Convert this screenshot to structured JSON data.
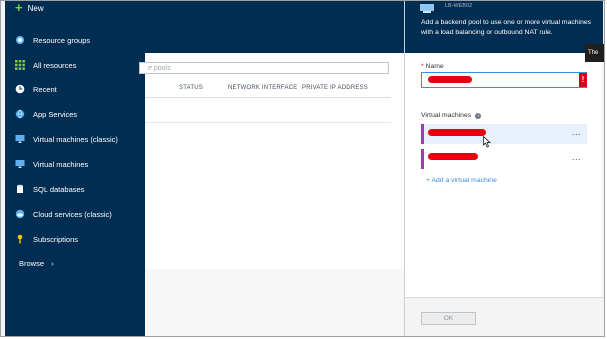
{
  "sidebar": {
    "new_label": "New",
    "items": [
      {
        "label": "Resource groups",
        "icon": "resource-groups-icon"
      },
      {
        "label": "All resources",
        "icon": "grid-icon"
      },
      {
        "label": "Recent",
        "icon": "clock-icon"
      },
      {
        "label": "App Services",
        "icon": "globe-icon"
      },
      {
        "label": "Virtual machines (classic)",
        "icon": "monitor-icon"
      },
      {
        "label": "Virtual machines",
        "icon": "monitor-icon"
      },
      {
        "label": "SQL databases",
        "icon": "database-icon"
      },
      {
        "label": "Cloud services (classic)",
        "icon": "cloud-icon"
      },
      {
        "label": "Subscriptions",
        "icon": "key-icon"
      }
    ],
    "browse_label": "Browse"
  },
  "middle": {
    "search_placeholder": "e pools",
    "columns": [
      "STATUS",
      "NETWORK INTERFACE",
      "PRIVATE IP ADDRESS"
    ]
  },
  "right": {
    "resource_name": "LB-WEB02",
    "description": "Add a backend pool to use one or more virtual machines with a load balancing or outbound NAT rule.",
    "name_label": "Name",
    "required_marker": "*",
    "error_badge": "!",
    "vm_label": "Virtual machines",
    "info_glyph": "i",
    "more_glyph": "...",
    "add_vm_label": "+ Add a virtual machine",
    "ok_label": "OK"
  },
  "tooltip": {
    "text": "The"
  },
  "colors": {
    "nav_bg": "#002d52",
    "accent": "#3c8bd9",
    "error": "#e8000f",
    "selected_row": "#e8f1fb"
  }
}
